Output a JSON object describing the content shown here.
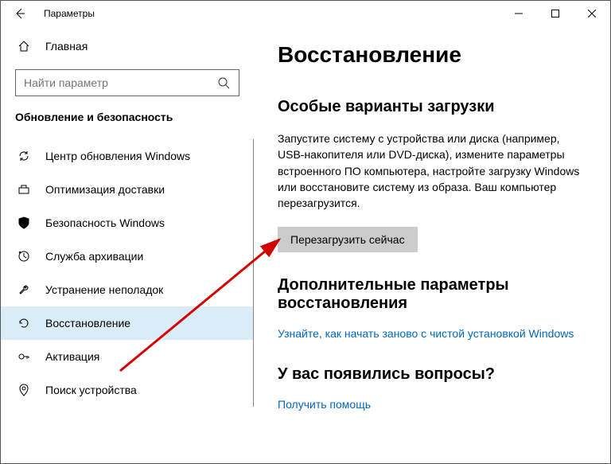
{
  "window": {
    "title": "Параметры"
  },
  "sidebar": {
    "home": "Главная",
    "searchPlaceholder": "Найти параметр",
    "section": "Обновление и безопасность",
    "items": [
      {
        "label": "Центр обновления Windows"
      },
      {
        "label": "Оптимизация доставки"
      },
      {
        "label": "Безопасность Windows"
      },
      {
        "label": "Служба архивации"
      },
      {
        "label": "Устранение неполадок"
      },
      {
        "label": "Восстановление"
      },
      {
        "label": "Активация"
      },
      {
        "label": "Поиск устройства"
      }
    ]
  },
  "content": {
    "heading": "Восстановление",
    "sub1": "Особые варианты загрузки",
    "desc": "Запустите систему с устройства или диска (например, USB-накопителя или DVD-диска), измените параметры встроенного ПО компьютера, настройте загрузку Windows или восстановите систему из образа. Ваш компьютер перезагрузится.",
    "button": "Перезагрузить сейчас",
    "sub2": "Дополнительные параметры восстановления",
    "link1": "Узнайте, как начать заново с чистой установкой Windows",
    "sub3": "У вас появились вопросы?",
    "link2": "Получить помощь"
  }
}
